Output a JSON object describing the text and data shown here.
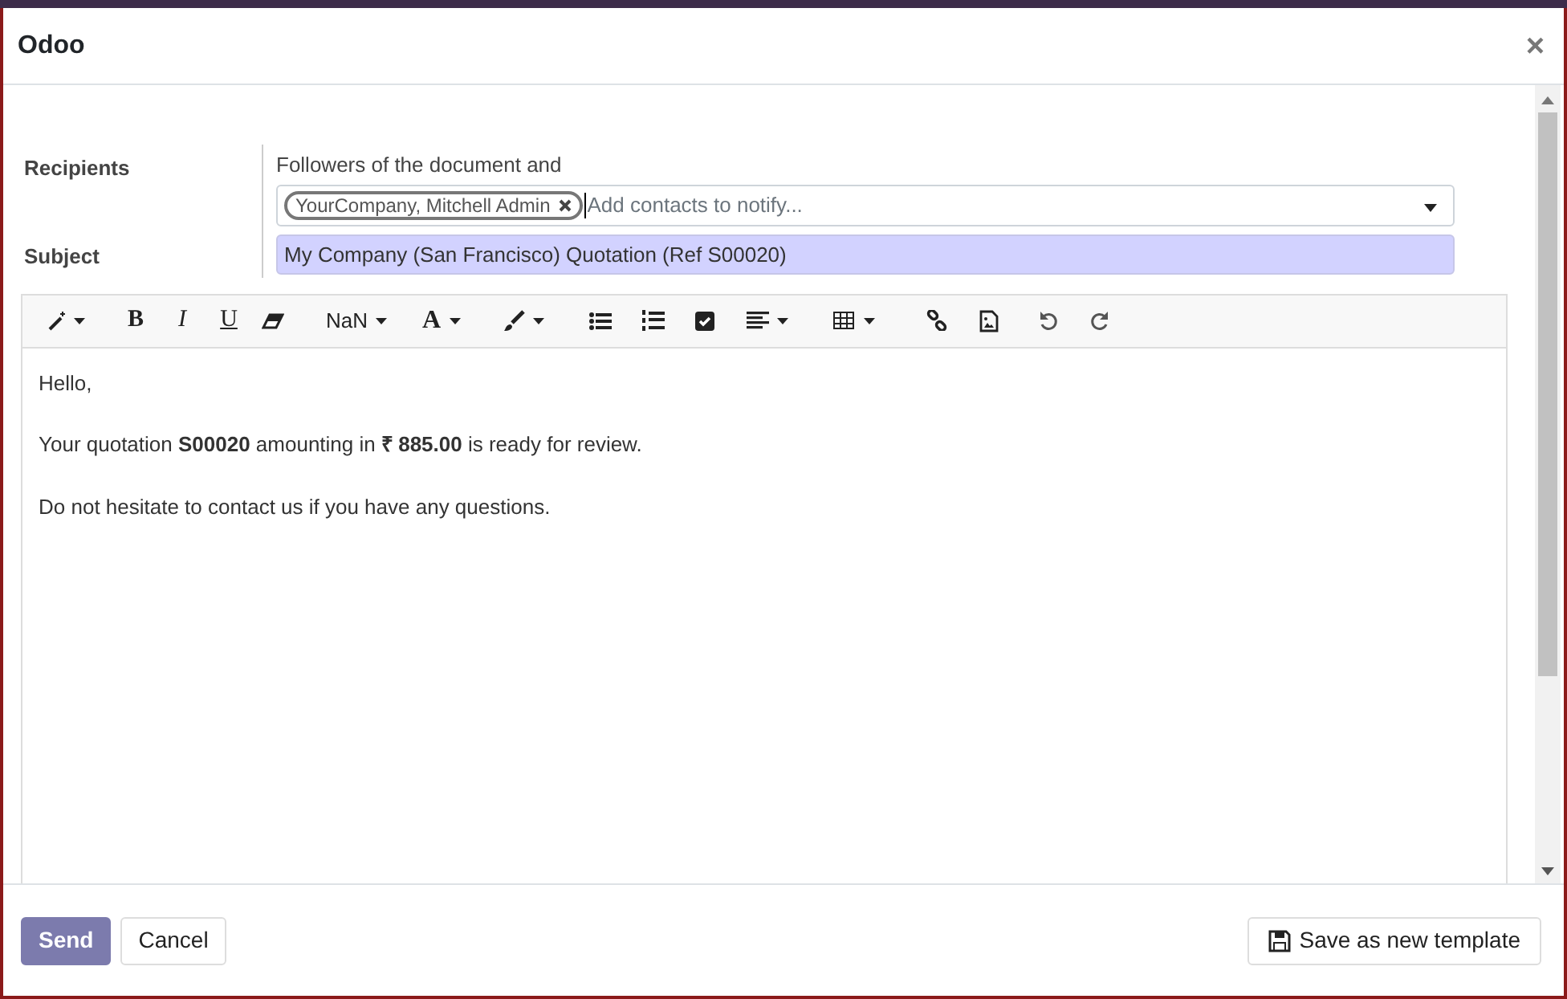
{
  "dialog": {
    "title": "Odoo",
    "close": "×"
  },
  "recipients": {
    "label": "Recipients",
    "intro": "Followers of the document and",
    "tags": [
      {
        "label": "YourCompany, Mitchell Admin"
      }
    ],
    "placeholder": "Add contacts to notify..."
  },
  "subject": {
    "label": "Subject",
    "value": "My Company (San Francisco) Quotation (Ref S00020)"
  },
  "toolbar": {
    "bold": "B",
    "italic": "I",
    "underline": "U",
    "font_size": "NaN",
    "text_color": "A"
  },
  "body": [
    "Hello,",
    "Your quotation **S00020** amounting in **₹ 885.00** is ready for review.",
    "Do not hesitate to contact us if you have any questions."
  ],
  "footer": {
    "buttons": [
      {
        "label": "Send",
        "kind": "primary"
      },
      {
        "label": "Cancel",
        "kind": "secondary"
      }
    ],
    "template_button": "Save as new template"
  }
}
